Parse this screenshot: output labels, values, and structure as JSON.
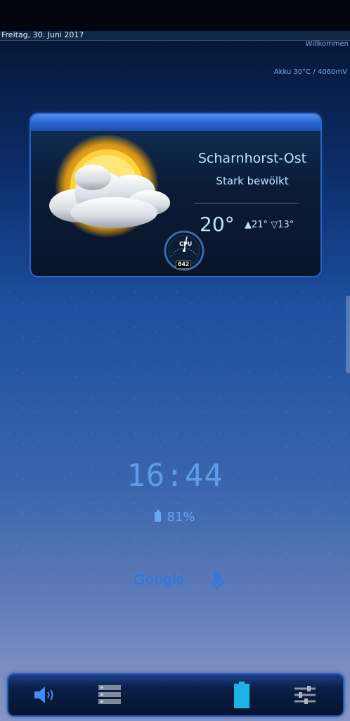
{
  "status": {
    "date": "Freitag, 30. Juni 2017",
    "welcome": "Willkommen",
    "akku": "Akku 30°C / 4060mV"
  },
  "weather": {
    "location": "Scharnhorst-Ost",
    "condition": "Stark bewölkt",
    "temperature": "20°",
    "high": "▲21°",
    "low": "▽13°",
    "icon": "partly-cloudy-icon",
    "cpu_label": "CPU",
    "cpu_value": "042"
  },
  "clock": {
    "time": "16:44",
    "battery": "81%"
  },
  "search": {
    "label": "Google",
    "mic_icon": "microphone-icon",
    "color": "#2f78de"
  },
  "dock": {
    "items": [
      "volume-icon",
      "storage-icon",
      "battery-icon",
      "settings-sliders-icon"
    ]
  },
  "colors": {
    "accent": "#2c63c6",
    "text_light": "#bfe4ff",
    "clock": "#5f9be8"
  }
}
